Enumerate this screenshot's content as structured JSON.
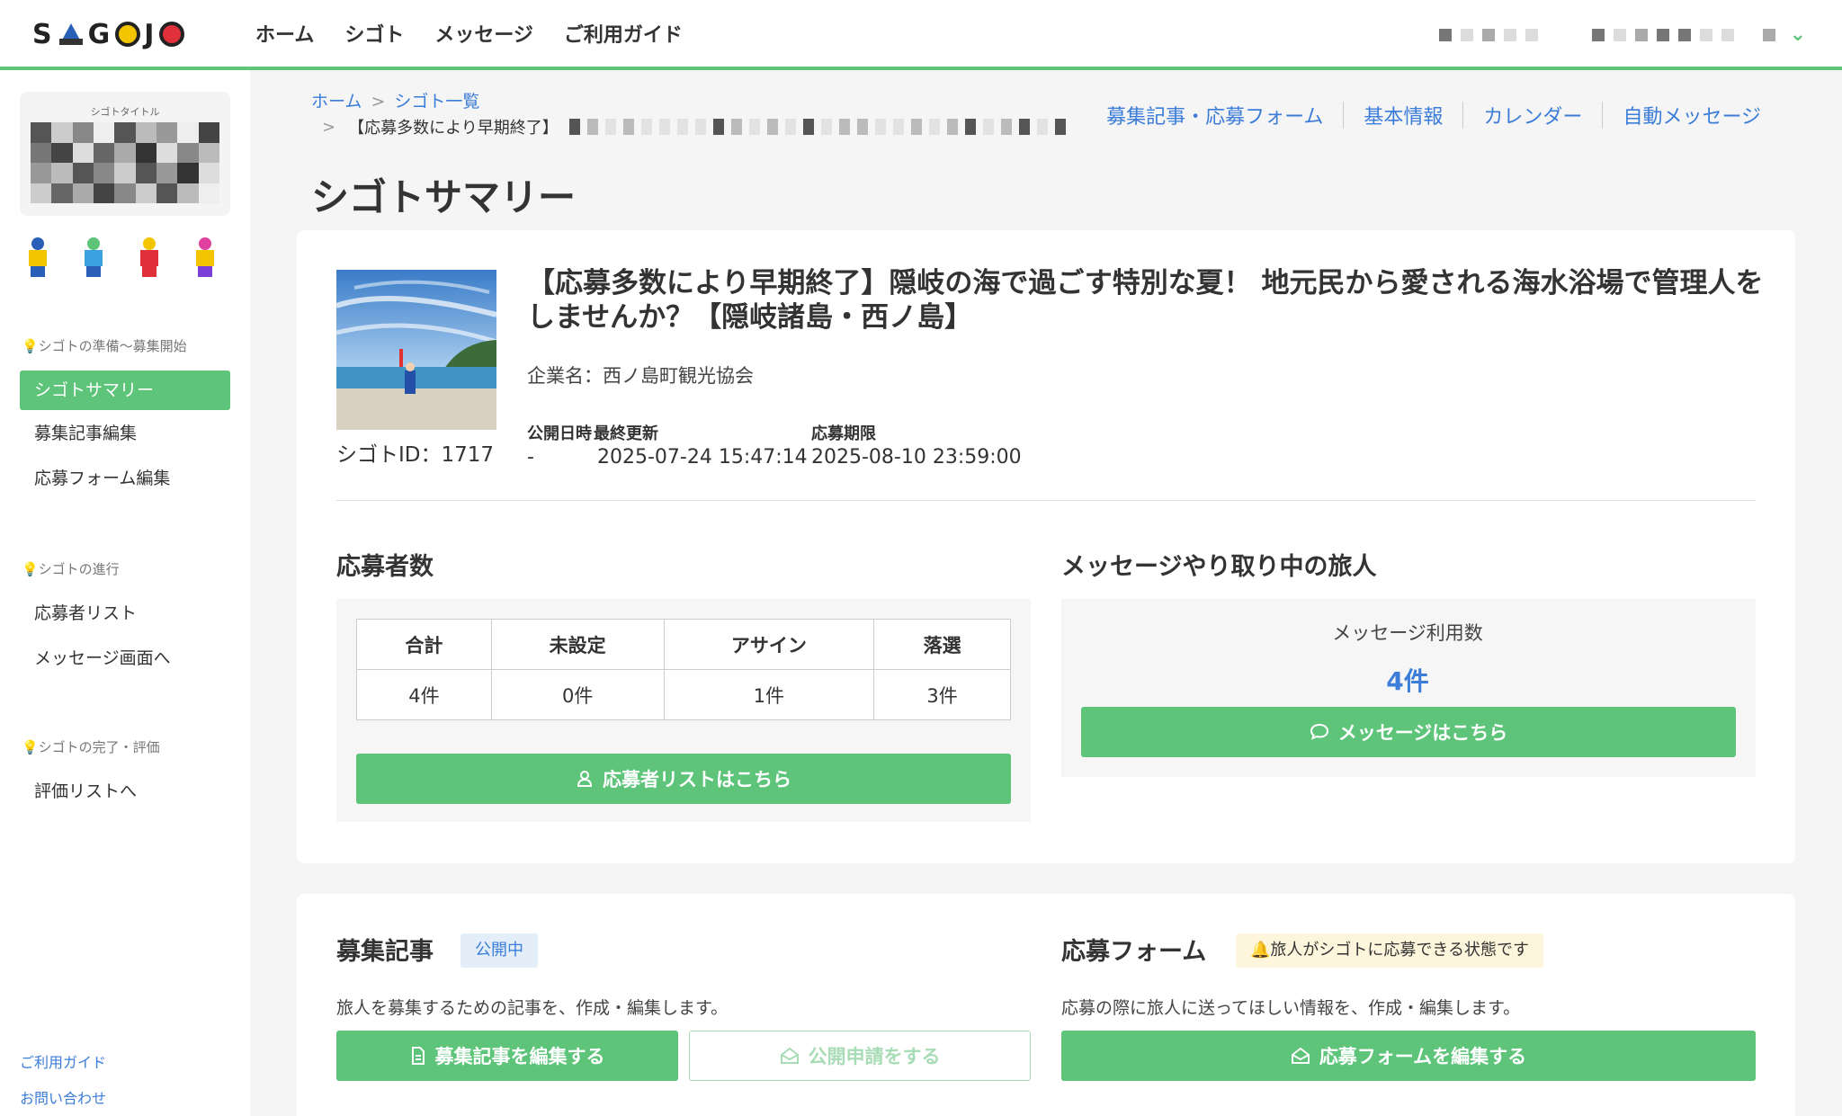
{
  "header": {
    "logo_letters": [
      "S",
      "G",
      "J"
    ],
    "nav": [
      "ホーム",
      "シゴト",
      "メッセージ",
      "ご利用ガイド"
    ]
  },
  "sidebar": {
    "title_card_caption": "シゴトタイトル",
    "sections": [
      {
        "label": "💡シゴトの準備〜募集開始",
        "items": [
          "シゴトサマリー",
          "募集記事編集",
          "応募フォーム編集"
        ]
      },
      {
        "label": "💡シゴトの進行",
        "items": [
          "応募者リスト",
          "メッセージ画面へ"
        ]
      },
      {
        "label": "💡シゴトの完了・評価",
        "items": [
          "評価リストへ"
        ]
      }
    ],
    "active_item": "シゴトサマリー",
    "footer_links": [
      "ご利用ガイド",
      "お問い合わせ"
    ]
  },
  "breadcrumb": {
    "home": "ホーム",
    "list": "シゴト一覧",
    "current_prefix": "【応募多数により早期終了】"
  },
  "tabs": [
    "募集記事・応募フォーム",
    "基本情報",
    "カレンダー",
    "自動メッセージ"
  ],
  "page_title": "シゴトサマリー",
  "job": {
    "id_label": "シゴトID：1717",
    "title": "【応募多数により早期終了】隠岐の海で過ごす特別な夏！ 地元民から愛される海水浴場で管理人をしませんか？【隠岐諸島・西ノ島】",
    "company": "企業名：西ノ島町観光協会",
    "meta": {
      "published_label": "公開日時",
      "published_value": "-",
      "updated_label": "最終更新",
      "updated_value": "2025-07-24 15:47:14",
      "deadline_label": "応募期限",
      "deadline_value": "2025-08-10 23:59:00"
    }
  },
  "applicants": {
    "heading": "応募者数",
    "columns": [
      "合計",
      "未設定",
      "アサイン",
      "落選"
    ],
    "values": [
      "4件",
      "0件",
      "1件",
      "3件"
    ],
    "button": "応募者リストはこちら"
  },
  "messages": {
    "heading": "メッセージやり取り中の旅人",
    "label": "メッセージ利用数",
    "count": "4件",
    "button": "メッセージはこちら"
  },
  "recruit_article": {
    "heading": "募集記事",
    "badge": "公開中",
    "desc": "旅人を募集するための記事を、作成・編集します。",
    "edit_button": "募集記事を編集する",
    "publish_button": "公開申請をする"
  },
  "application_form": {
    "heading": "応募フォーム",
    "badge": "🔔旅人がシゴトに応募できる状態です",
    "desc": "応募の際に旅人に送ってほしい情報を、作成・編集します。",
    "edit_button": "応募フォームを編集する"
  },
  "colors": {
    "accent_green": "#5ec47a",
    "link_blue": "#3b7dd8"
  }
}
